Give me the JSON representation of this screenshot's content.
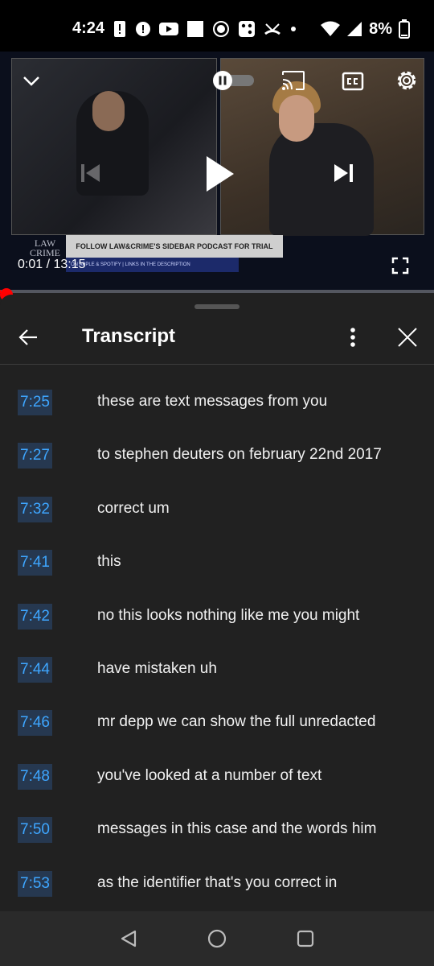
{
  "status_bar": {
    "time": "4:24",
    "battery_percent": "8%"
  },
  "player": {
    "current_time": "0:01",
    "separator": " / ",
    "duration": "13:15",
    "banner_text": "FOLLOW LAW&CRIME'S SIDEBAR PODCAST FOR TRIAL RECAPS",
    "subbanner_text": "ON APPLE & SPOTIFY | LINKS IN THE DESCRIPTION",
    "logo_line1": "LAW",
    "logo_line2": "CRIME",
    "progress_fraction": 0.001,
    "progress_color": "#ff0000"
  },
  "transcript": {
    "title": "Transcript",
    "rows": [
      {
        "time": "7:25",
        "text": "these are text messages from you"
      },
      {
        "time": "7:27",
        "text": "to stephen deuters on february 22nd 2017"
      },
      {
        "time": "7:32",
        "text": "correct um"
      },
      {
        "time": "7:41",
        "text": "this"
      },
      {
        "time": "7:42",
        "text": "no this looks nothing like me you might"
      },
      {
        "time": "7:44",
        "text": "have mistaken uh"
      },
      {
        "time": "7:46",
        "text": "mr depp we can show the full unredacted"
      },
      {
        "time": "7:48",
        "text": "you've looked at a number of text"
      },
      {
        "time": "7:50",
        "text": "messages in this case and the words him"
      },
      {
        "time": "7:53",
        "text": "as the identifier that's you correct in"
      }
    ]
  },
  "colors": {
    "accent": "#3ea6ff",
    "timestamp_bg": "#263850",
    "sheet_bg": "#212121"
  },
  "icons": [
    "back-arrow-icon",
    "more-vert-icon",
    "close-icon",
    "chevron-down-icon",
    "pause-toggle-icon",
    "cast-icon",
    "cc-icon",
    "settings-icon",
    "play-icon",
    "skip-next-icon",
    "skip-previous-icon",
    "fullscreen-icon"
  ]
}
